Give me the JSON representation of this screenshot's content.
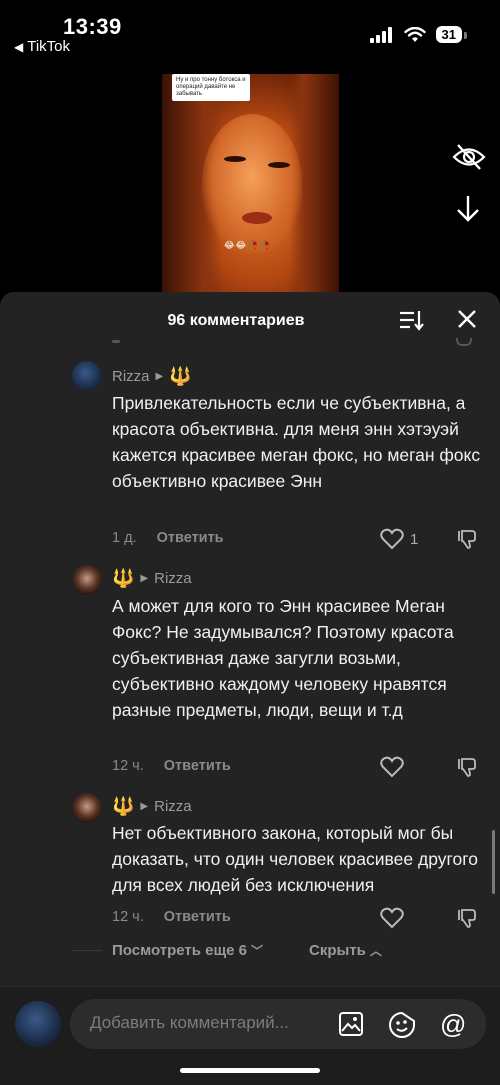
{
  "status_bar": {
    "time": "13:39",
    "back_app": "TikTok",
    "battery": "31"
  },
  "video": {
    "sticker_text": "Ну и про тонну ботокса и операций давайте не забывать",
    "emoji_row": "😂😂🥀🥀"
  },
  "sheet": {
    "title": "96 комментариев",
    "comments": [
      {
        "user": "Rizza",
        "badge": "🔱",
        "text": "Привлекательность если че субъективна, а красота объективна. для меня энн хэтэуэй кажется красивее меган фокс, но меган фокс объективно красивее Энн",
        "time": "1 д.",
        "reply": "Ответить",
        "likes": "1"
      },
      {
        "user": "Rizza",
        "badge": "🔱",
        "text": "А может для кого то Энн красивее Меган Фокс? Не задумывался? Поэтому красота субъективная даже загугли возьми, субъективно каждому человеку нравятся разные предметы, люди, вещи и т.д",
        "time": "12 ч.",
        "reply": "Ответить",
        "likes": ""
      },
      {
        "user": "Rizza",
        "badge": "🔱",
        "text": "Нет объективного закона, который мог бы доказать, что один человек красивее другого для всех людей без исключения",
        "time": "12 ч.",
        "reply": "Ответить",
        "likes": ""
      }
    ],
    "view_more": "Посмотреть еще 6",
    "hide": "Скрыть"
  },
  "input": {
    "placeholder": "Добавить комментарий..."
  },
  "colors": {
    "sheet_bg": "#232323",
    "text_primary": "#f1f1f1",
    "text_secondary": "#8a8a8a"
  }
}
